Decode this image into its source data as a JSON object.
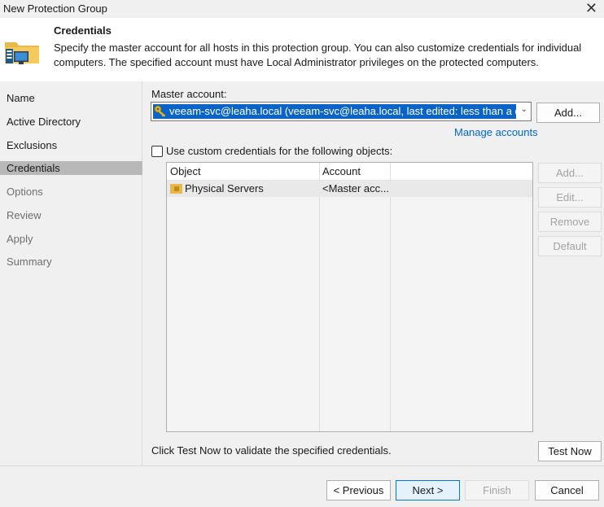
{
  "window": {
    "title": "New Protection Group",
    "close_glyph": "✕"
  },
  "header": {
    "title": "Credentials",
    "description": "Specify the master account for all hosts in this protection group. You can also customize credentials for individual computers. The specified account must have Local Administrator privileges on the protected computers.",
    "icon": "folder-computer-icon"
  },
  "sidebar": {
    "items": [
      {
        "label": "Name",
        "state": "normal"
      },
      {
        "label": "Active Directory",
        "state": "normal"
      },
      {
        "label": "Exclusions",
        "state": "normal"
      },
      {
        "label": "Credentials",
        "state": "active"
      },
      {
        "label": "Options",
        "state": "disabled"
      },
      {
        "label": "Review",
        "state": "disabled"
      },
      {
        "label": "Apply",
        "state": "disabled"
      },
      {
        "label": "Summary",
        "state": "disabled"
      }
    ]
  },
  "main": {
    "master_account_label": "Master account:",
    "master_account_value": "veeam-svc@leaha.local (veeam-svc@leaha.local, last edited: less than a day ago)",
    "add_label": "Add...",
    "manage_accounts_label": "Manage accounts",
    "custom_credentials_label": "Use custom credentials for the following objects:",
    "custom_credentials_checked": false,
    "table": {
      "columns": [
        "Object",
        "Account"
      ],
      "rows": [
        {
          "object": "Physical Servers",
          "account": "<Master acc..."
        }
      ]
    },
    "side_buttons": {
      "add": "Add...",
      "edit": "Edit...",
      "remove": "Remove",
      "default": "Default"
    },
    "test_hint": "Click Test Now to validate the specified credentials.",
    "test_now_label": "Test Now"
  },
  "footer": {
    "previous": "< Previous",
    "next": "Next >",
    "finish": "Finish",
    "cancel": "Cancel"
  },
  "colors": {
    "selection": "#0a64c8",
    "link": "#0066cc",
    "active_nav": "#b8b8b8"
  }
}
